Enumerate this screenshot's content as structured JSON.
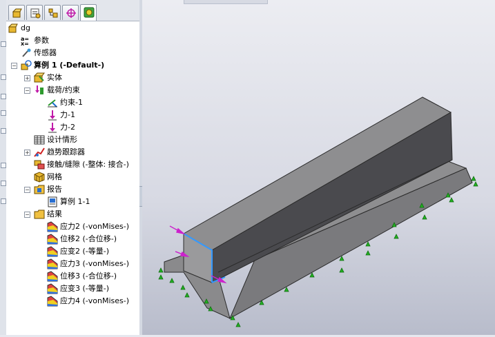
{
  "panel": {
    "tabs": [
      {
        "name": "featuremanager-tab"
      },
      {
        "name": "propertymanager-tab"
      },
      {
        "name": "configurationmanager-tab"
      },
      {
        "name": "dimxpert-tab"
      },
      {
        "name": "simulation-tab"
      }
    ]
  },
  "tree": {
    "root": "dg",
    "params": "参数",
    "sensors": "传感器",
    "study": "算例 1 (-Default-)",
    "solid": "实体",
    "loads": "载荷/约束",
    "fixture1": "约束-1",
    "force1": "力-1",
    "force2": "力-2",
    "scenario": "设计情形",
    "trend": "趋势跟踪器",
    "contact": "接触/缝隙 (-整体: 接合-)",
    "mesh": "网格",
    "report": "报告",
    "report_item": "算例 1-1",
    "results": "结果",
    "results_items": [
      "应力2 (-vonMises-)",
      "位移2 (-合位移-)",
      "应变2 (-等量-)",
      "应力3 (-vonMises-)",
      "位移3 (-合位移-)",
      "应变3 (-等量-)",
      "应力4 (-vonMises-)"
    ]
  },
  "colors": {
    "model_top": "#8e8e90",
    "model_side": "#4a4a4e",
    "fixture_arrow": "#22b022",
    "force_arrow": "#cc22cc",
    "edge_highlight": "#3399ff"
  }
}
